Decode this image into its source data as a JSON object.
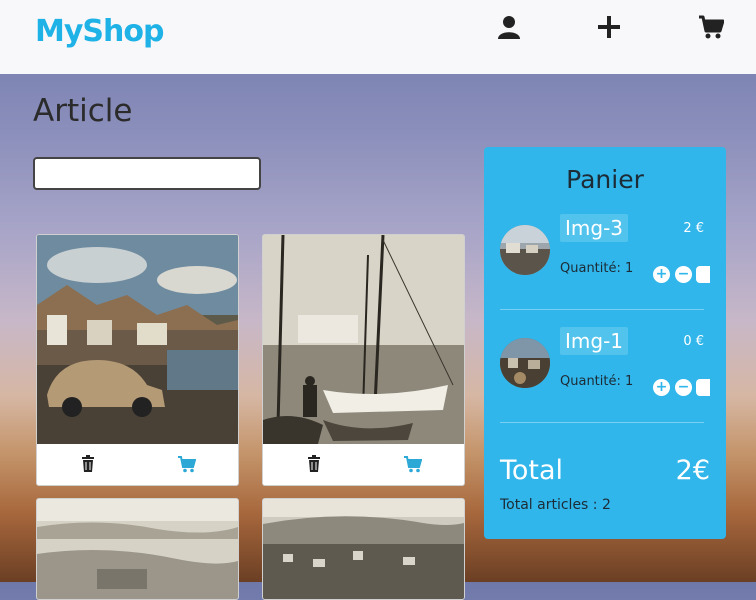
{
  "header": {
    "logo_text": "MyShop",
    "icons": [
      "user-icon",
      "plus-icon",
      "cart-icon"
    ],
    "brand_color": "#1fb2e6"
  },
  "main": {
    "title": "Article",
    "search": {
      "value": "",
      "placeholder": ""
    },
    "cards": [
      {
        "image": "street-with-vintage-car",
        "actions": [
          "trash-icon",
          "cart-icon"
        ]
      },
      {
        "image": "harbor-sailboats",
        "actions": [
          "trash-icon",
          "cart-icon"
        ]
      },
      {
        "image": "coastal-town-aerial",
        "actions": []
      },
      {
        "image": "coastal-village-aerial",
        "actions": []
      }
    ]
  },
  "cart": {
    "title": "Panier",
    "items": [
      {
        "name": "Img-3",
        "price": "2 €",
        "quantity_label": "Quantité: 1",
        "thumb": "street-thumb"
      },
      {
        "name": "Img-1",
        "price": "0 €",
        "quantity_label": "Quantité: 1",
        "thumb": "town-thumb"
      }
    ],
    "total_label": "Total",
    "total_value": "2€",
    "total_articles": "Total articles : 2",
    "panel_color": "#30b6ea"
  }
}
